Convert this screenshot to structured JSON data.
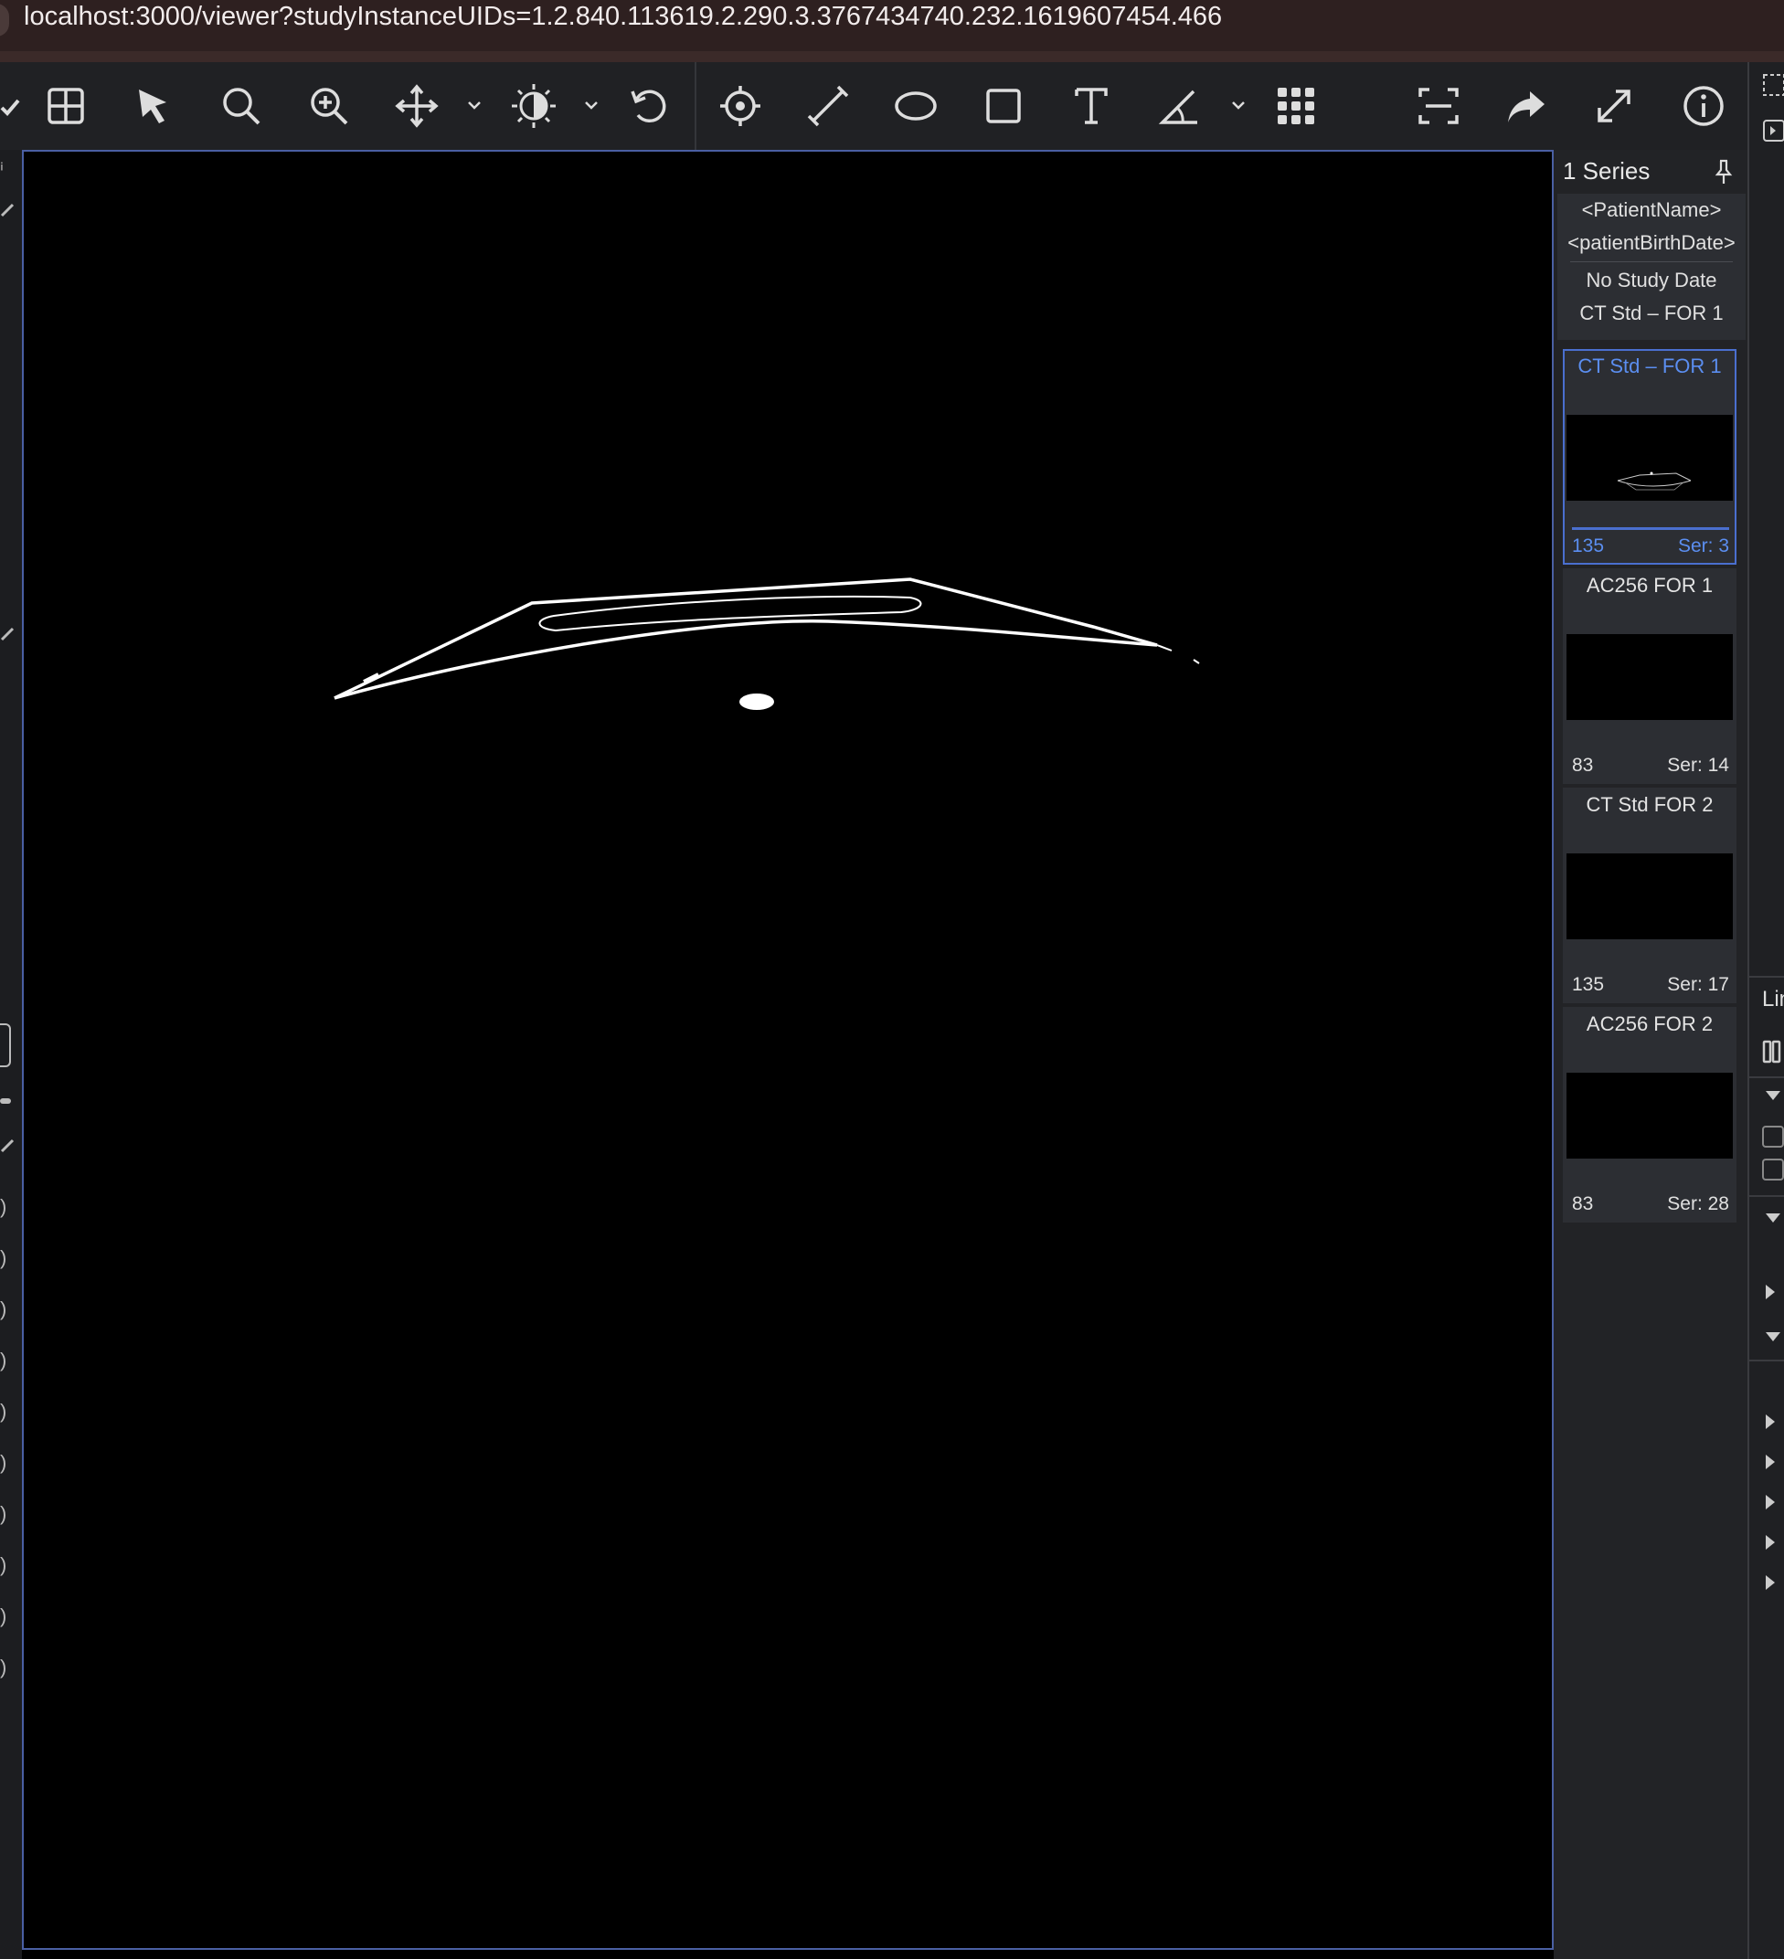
{
  "browser": {
    "url": "localhost:3000/viewer?studyInstanceUIDs=1.2.840.113619.2.290.3.3767434740.232.1619607454.466"
  },
  "toolbar": {
    "tools": [
      {
        "name": "layout-grid-icon"
      },
      {
        "name": "pointer-icon"
      },
      {
        "name": "zoom-icon"
      },
      {
        "name": "magnify-plus-icon"
      },
      {
        "name": "pan-icon"
      },
      {
        "name": "window-level-icon"
      },
      {
        "name": "reset-icon"
      },
      {
        "name": "crosshair-icon"
      },
      {
        "name": "length-icon"
      },
      {
        "name": "ellipse-icon"
      },
      {
        "name": "rectangle-icon"
      },
      {
        "name": "text-icon"
      },
      {
        "name": "angle-icon"
      },
      {
        "name": "more-tools-grid-icon"
      },
      {
        "name": "capture-icon"
      },
      {
        "name": "share-icon"
      },
      {
        "name": "fullscreen-icon"
      },
      {
        "name": "info-icon"
      }
    ]
  },
  "series_panel": {
    "header": "1 Series",
    "study": {
      "patient_name": "<PatientName>",
      "patient_birth_date": "<patientBirthDate>",
      "study_date": "No Study Date",
      "description": "CT Std – FOR 1"
    },
    "thumbnails": [
      {
        "title": "CT Std – FOR 1",
        "count": "135",
        "series": "Ser: 3",
        "active": true
      },
      {
        "title": "AC256 FOR 1",
        "count": "83",
        "series": "Ser: 14",
        "active": false
      },
      {
        "title": "CT Std FOR 2",
        "count": "135",
        "series": "Ser: 17",
        "active": false
      },
      {
        "title": "AC256 FOR 2",
        "count": "83",
        "series": "Ser: 28",
        "active": false
      }
    ]
  },
  "right_panel": {
    "label": "Lin"
  },
  "colors": {
    "accent": "#4a6fcf",
    "viewport_border": "#4a5fa3",
    "toolbar_bg": "#202124",
    "panel_bg": "#222326"
  }
}
